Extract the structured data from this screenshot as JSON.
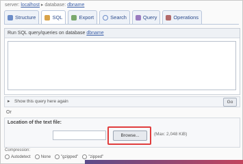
{
  "breadcrumb": {
    "prefix": "server: ",
    "server": "localhost",
    "separator": " ▸ database: ",
    "database": "dbname"
  },
  "tabs": [
    {
      "label": "Structure",
      "icon": "table-icon"
    },
    {
      "label": "SQL",
      "icon": "sql-icon"
    },
    {
      "label": "Export",
      "icon": "export-icon"
    },
    {
      "label": "Search",
      "icon": "search-icon"
    },
    {
      "label": "Query",
      "icon": "query-icon"
    },
    {
      "label": "Operations",
      "icon": "operations-icon"
    }
  ],
  "sql": {
    "header_text": "Run SQL query/queries on database ",
    "header_link": "dbname",
    "textarea_value": ""
  },
  "bookmark": {
    "toggle": "▸",
    "label": "Show this query here again",
    "go": "Go"
  },
  "or_text": "Or",
  "upload": {
    "label": "Location of the text file:",
    "browse_label": "Browse...",
    "max_size": "(Max: 2,048 KiB)"
  },
  "options": {
    "title": "Compression:",
    "items": [
      "Autodetect",
      "None",
      "\"gzipped\"",
      "\"zipped\""
    ]
  },
  "colors": {
    "highlight": "#e03c3c",
    "link": "#3b5fa8",
    "accent_bar": "#5b4b8a"
  }
}
